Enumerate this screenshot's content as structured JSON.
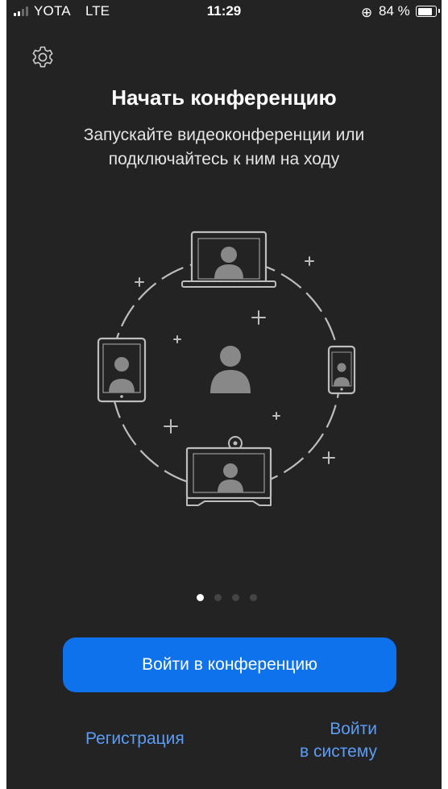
{
  "status_bar": {
    "carrier": "YOTA",
    "network": "LTE",
    "time": "11:29",
    "rotation_lock_icon": "⊕",
    "battery_percent": "84 %"
  },
  "header": {
    "settings_icon": "gear-icon",
    "title": "Начать конференцию",
    "subtitle": "Запускайте видеоконференции или подключайтесь к ним на ходу"
  },
  "carousel": {
    "page_count": 4,
    "active_page": 1
  },
  "actions": {
    "join_label": "Войти в конференцию",
    "signup_label": "Регистрация",
    "signin_line1": "Войти",
    "signin_line2": "в систему"
  },
  "colors": {
    "background": "#232323",
    "accent": "#0e72ed",
    "link": "#5b9cf5"
  }
}
